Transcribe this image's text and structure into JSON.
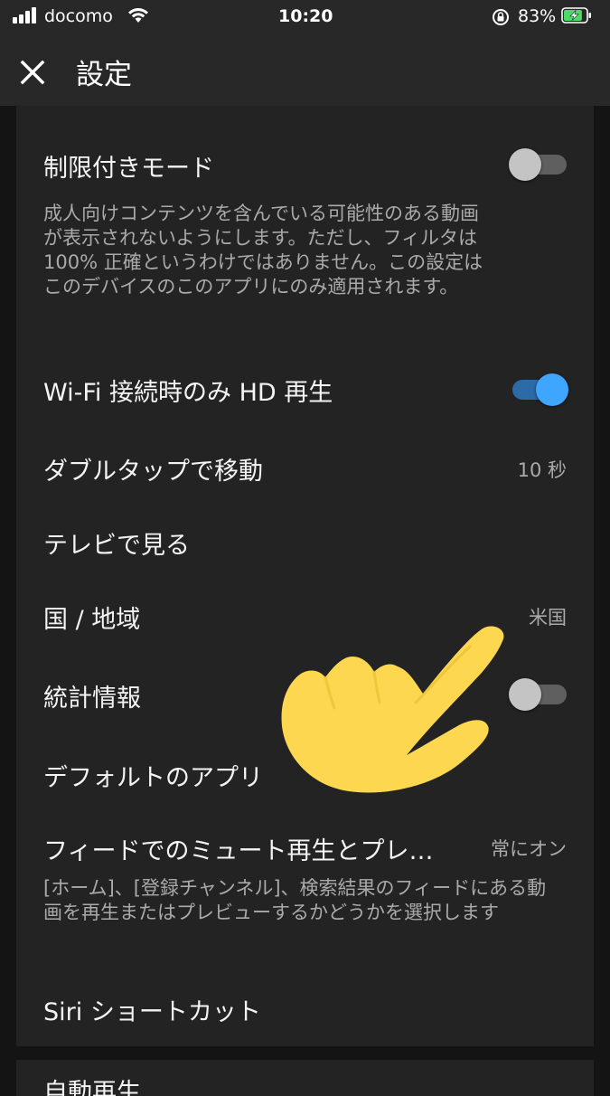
{
  "status_bar": {
    "carrier": "docomo",
    "time": "10:20",
    "battery_percent": "83%",
    "battery_level": 0.83,
    "charging": true,
    "icons": [
      "signal-icon",
      "wifi-icon",
      "rotation-lock-icon",
      "battery-icon"
    ]
  },
  "app_bar": {
    "title": "設定",
    "close_icon": "close-icon"
  },
  "settings": {
    "restricted_mode": {
      "title": "制限付きモード",
      "description": "成人向けコンテンツを含んでいる可能性のある動画が表示されないようにします。ただし、フィルタは 100% 正確というわけではありません。この設定はこのデバイスのこのアプリにのみ適用されます。",
      "enabled": false
    },
    "hd_wifi_only": {
      "title": "Wi-Fi 接続時のみ HD 再生",
      "enabled": true
    },
    "double_tap": {
      "title": "ダブルタップで移動",
      "value": "10 秒"
    },
    "watch_on_tv": {
      "title": "テレビで見る"
    },
    "region": {
      "title": "国 / 地域",
      "value": "米国"
    },
    "stats": {
      "title": "統計情報",
      "enabled": false
    },
    "default_apps": {
      "title": "デフォルトのアプリ"
    },
    "muted_playback": {
      "title": "フィードでのミュート再生とプレ…",
      "value": "常にオン",
      "description": "[ホーム]、[登録チャンネル]、検索結果のフィードにある動画を再生またはプレビューするかどうかを選択します"
    },
    "siri_shortcuts": {
      "title": "Siri ショートカット"
    },
    "autoplay_section": {
      "title": "自動再生"
    }
  },
  "overlay": {
    "icon": "pointing-hand-icon",
    "color": "#fcd74f"
  },
  "colors": {
    "background": "#141414",
    "card": "#232323",
    "toggle_on": "#3ea6ff"
  }
}
